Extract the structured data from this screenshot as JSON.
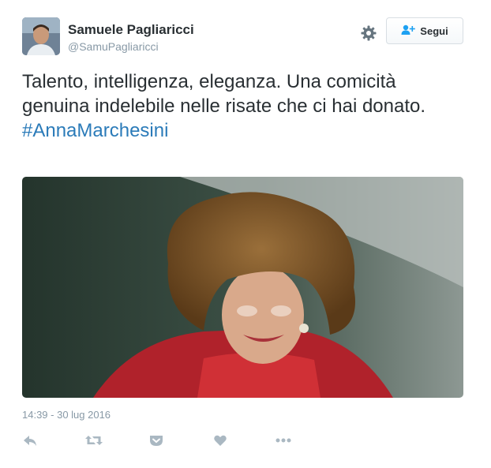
{
  "tweet": {
    "author_name": "Samuele Pagliaricci",
    "author_handle": "@SamuPagliaricci",
    "follow_label": "Segui",
    "text": "Talento, intelligenza, eleganza. Una comicità genuina indelebile nelle risate che ci hai donato.",
    "hashtag": "#AnnaMarchesini",
    "timestamp": "14:39 - 30 lug 2016"
  },
  "icons": {
    "settings": "gear-icon",
    "follow": "add-user-icon",
    "reply": "reply-icon",
    "retweet": "retweet-icon",
    "save": "pocket-icon",
    "like": "heart-icon",
    "more": "more-dots-icon"
  },
  "colors": {
    "link": "#2b7bb9",
    "follow_icon": "#1da1f2",
    "muted": "#8899a6",
    "action_icon": "#aab8c2"
  }
}
